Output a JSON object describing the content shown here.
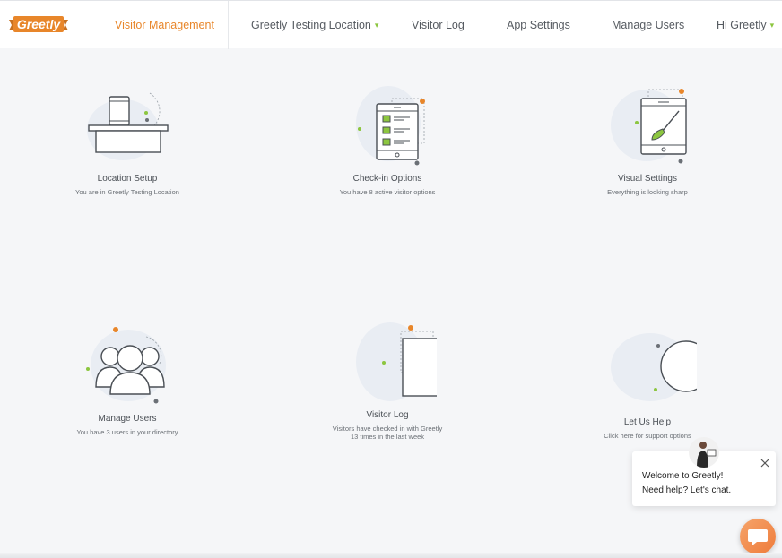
{
  "brand": {
    "logo_text": "Greetly",
    "accent": "#e8862a",
    "green": "#8cc63f"
  },
  "nav": {
    "visitor_management": "Visitor Management",
    "location": "Greetly Testing Location",
    "location_caret": "▾",
    "visitor_log": "Visitor Log",
    "app_settings": "App Settings",
    "manage_users": "Manage Users",
    "user_greeting": "Hi Greetly",
    "user_caret": "▾"
  },
  "cards": [
    {
      "title": "Location Setup",
      "subtitle": "You are in Greetly Testing Location",
      "icon": "desk-phone-icon"
    },
    {
      "title": "Check-in Options",
      "subtitle": "You have 8 active visitor options",
      "icon": "checklist-tablet-icon"
    },
    {
      "title": "Visual Settings",
      "subtitle": "Everything is looking sharp",
      "icon": "paintbrush-tablet-icon"
    },
    {
      "title": "Manage Users",
      "subtitle": "You have 3 users in your directory",
      "icon": "users-group-icon"
    },
    {
      "title": "Visitor Log",
      "subtitle_line1": "Visitors have checked in with Greetly",
      "subtitle_line2": "13 times in the last week",
      "icon": "visitor-book-icon"
    },
    {
      "title": "Let Us Help",
      "subtitle": "Click here for support options",
      "icon": "support-smiley-icon"
    }
  ],
  "chat": {
    "line1": "Welcome to Greetly!",
    "line2": "Need help? Let's chat."
  }
}
